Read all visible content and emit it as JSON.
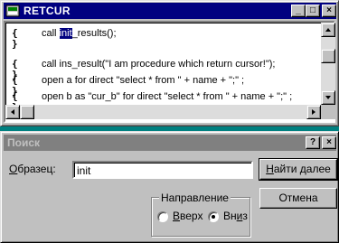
{
  "editor_window": {
    "title": "RETCUR",
    "controls": {
      "minimize": "_",
      "maximize": "□",
      "close": "×"
    },
    "lines": [
      {
        "marker": "{ }",
        "before": "call ",
        "selected": "init",
        "after": "_results();"
      },
      {
        "marker": "",
        "text": ""
      },
      {
        "marker": "{ }",
        "text": "call ins_result(\"I am procedure which return cursor!\");"
      },
      {
        "marker": "{ }",
        "text": "open a for direct \"select * from \" + name + \";\" ;"
      },
      {
        "marker": "{ }",
        "text": "open b as \"cur_b\" for direct \"select * from \" + name + \";\" ;"
      }
    ]
  },
  "find_dialog": {
    "title": "Поиск",
    "controls": {
      "help": "?",
      "close": "×"
    },
    "pattern": {
      "label_u": "О",
      "label_rest": "бразец:",
      "value": "init"
    },
    "find_next_button": {
      "u": "Н",
      "rest": "айти далее"
    },
    "cancel_button": {
      "label": "Отмена"
    },
    "direction": {
      "title": "Направление",
      "up": {
        "u": "В",
        "rest": "верх",
        "checked": false
      },
      "down": {
        "before": "Вн",
        "u": "и",
        "rest": "з",
        "checked": true
      }
    }
  }
}
